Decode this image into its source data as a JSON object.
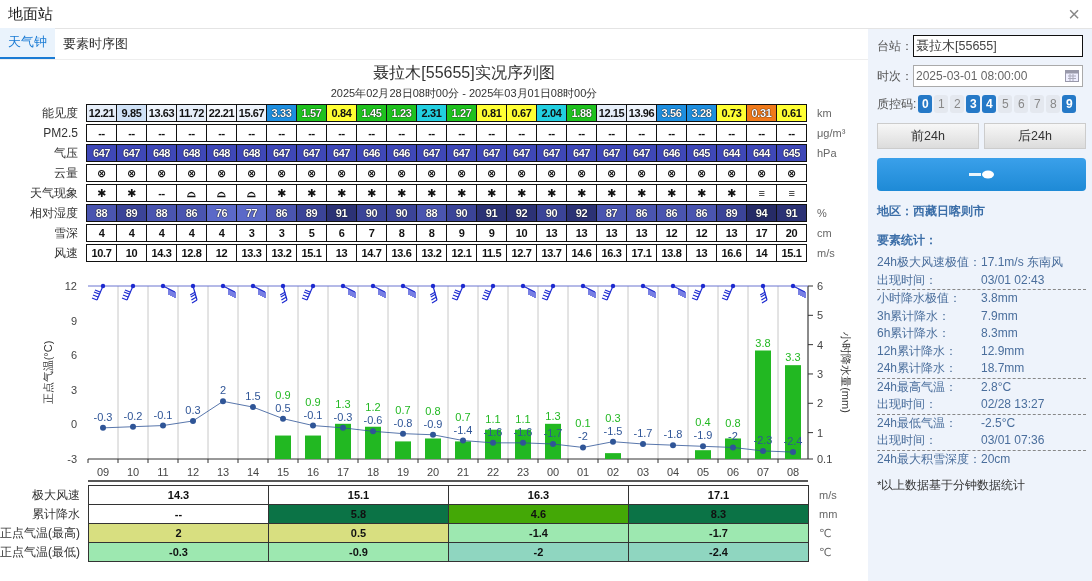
{
  "window": {
    "title": "地面站",
    "close": "×"
  },
  "tabs": [
    {
      "label": "天气钟",
      "selected": true
    },
    {
      "label": "要素时序图",
      "selected": false
    }
  ],
  "report": {
    "title": "聂拉木[55655]实况序列图",
    "subtitle": "2025年02月28日08时00分 - 2025年03月01日08时00分"
  },
  "table": {
    "rows": [
      {
        "label": "能见度",
        "unit": "km",
        "cells": [
          {
            "text": "12.21",
            "color": "#e6eef9"
          },
          {
            "text": "9.85",
            "color": "#cfe1f6"
          },
          {
            "text": "13.63",
            "color": "#edf3fb"
          },
          {
            "text": "11.72",
            "color": "#e6eef9"
          },
          {
            "text": "22.21",
            "color": "#f4f7fc"
          },
          {
            "text": "15.67",
            "color": "#edf3fb"
          },
          {
            "text": "3.33",
            "color": "#1e8fe0"
          },
          {
            "text": "1.57",
            "color": "#1fc21f"
          },
          {
            "text": "0.84",
            "color": "#ffff33"
          },
          {
            "text": "1.45",
            "color": "#1fc21f"
          },
          {
            "text": "1.23",
            "color": "#1fc21f"
          },
          {
            "text": "2.31",
            "color": "#22cfe0"
          },
          {
            "text": "1.27",
            "color": "#1fc21f"
          },
          {
            "text": "0.81",
            "color": "#ffff33"
          },
          {
            "text": "0.67",
            "color": "#ffff33"
          },
          {
            "text": "2.04",
            "color": "#22cfe0"
          },
          {
            "text": "1.88",
            "color": "#1fc21f"
          },
          {
            "text": "12.15",
            "color": "#e6eef9"
          },
          {
            "text": "13.96",
            "color": "#edf3fb"
          },
          {
            "text": "3.56",
            "color": "#1e8fe0"
          },
          {
            "text": "3.28",
            "color": "#1e8fe0"
          },
          {
            "text": "0.73",
            "color": "#ffff33"
          },
          {
            "text": "0.31",
            "color": "#f07a1a"
          },
          {
            "text": "0.61",
            "color": "#ffff33"
          }
        ]
      },
      {
        "label": "PM2.5",
        "unit": "μg/m³",
        "cells": [
          "--",
          "--",
          "--",
          "--",
          "--",
          "--",
          "--",
          "--",
          "--",
          "--",
          "--",
          "--",
          "--",
          "--",
          "--",
          "--",
          "--",
          "--",
          "--",
          "--",
          "--",
          "--",
          "--",
          "--"
        ]
      },
      {
        "label": "气压",
        "unit": "hPa",
        "cells": [
          {
            "text": "647",
            "color": "#3f48b8"
          },
          {
            "text": "647",
            "color": "#3f48b8"
          },
          {
            "text": "648",
            "color": "#3f48b8"
          },
          {
            "text": "648",
            "color": "#3f48b8"
          },
          {
            "text": "648",
            "color": "#3f48b8"
          },
          {
            "text": "648",
            "color": "#3f48b8"
          },
          {
            "text": "647",
            "color": "#3f48b8"
          },
          {
            "text": "647",
            "color": "#3f48b8"
          },
          {
            "text": "647",
            "color": "#3f48b8"
          },
          {
            "text": "646",
            "color": "#3f48b8"
          },
          {
            "text": "646",
            "color": "#3f48b8"
          },
          {
            "text": "647",
            "color": "#3f48b8"
          },
          {
            "text": "647",
            "color": "#3f48b8"
          },
          {
            "text": "647",
            "color": "#3f48b8"
          },
          {
            "text": "647",
            "color": "#3f48b8"
          },
          {
            "text": "647",
            "color": "#3f48b8"
          },
          {
            "text": "647",
            "color": "#3f48b8"
          },
          {
            "text": "647",
            "color": "#3f48b8"
          },
          {
            "text": "647",
            "color": "#3f48b8"
          },
          {
            "text": "646",
            "color": "#3f48b8"
          },
          {
            "text": "645",
            "color": "#3f48b8"
          },
          {
            "text": "644",
            "color": "#3f48b8"
          },
          {
            "text": "644",
            "color": "#3f48b8"
          },
          {
            "text": "645",
            "color": "#3f48b8"
          }
        ]
      },
      {
        "label": "云量",
        "cells": [
          "⊗",
          "⊗",
          "⊗",
          "⊗",
          "⊗",
          "⊗",
          "⊗",
          "⊗",
          "⊗",
          "⊗",
          "⊗",
          "⊗",
          "⊗",
          "⊗",
          "⊗",
          "⊗",
          "⊗",
          "⊗",
          "⊗",
          "⊗",
          "⊗",
          "⊗",
          "⊗",
          "⊗"
        ]
      },
      {
        "label": "天气现象",
        "cells": [
          "✱",
          "✱",
          "--",
          "⌓",
          "⌓",
          "⌓",
          "✱",
          "✱",
          "✱",
          "✱",
          "✱",
          "✱",
          "✱",
          "✱",
          "✱",
          "✱",
          "✱",
          "✱",
          "✱",
          "✱",
          "✱",
          "✱",
          "≡",
          "≡"
        ]
      },
      {
        "label": "相对湿度",
        "unit": "%",
        "cells": [
          {
            "text": "88",
            "color": "#4a55b0"
          },
          {
            "text": "89",
            "color": "#3b4498"
          },
          {
            "text": "88",
            "color": "#4a55b0"
          },
          {
            "text": "86",
            "color": "#4a55b0"
          },
          {
            "text": "76",
            "color": "#5b69c8"
          },
          {
            "text": "77",
            "color": "#5b69c8"
          },
          {
            "text": "86",
            "color": "#4a55b0"
          },
          {
            "text": "89",
            "color": "#3b4498"
          },
          {
            "text": "91",
            "color": "#2c3275"
          },
          {
            "text": "90",
            "color": "#3b4498"
          },
          {
            "text": "90",
            "color": "#3b4498"
          },
          {
            "text": "88",
            "color": "#4a55b0"
          },
          {
            "text": "90",
            "color": "#3b4498"
          },
          {
            "text": "91",
            "color": "#2c3275"
          },
          {
            "text": "92",
            "color": "#2c3275"
          },
          {
            "text": "90",
            "color": "#3b4498"
          },
          {
            "text": "92",
            "color": "#2c3275"
          },
          {
            "text": "87",
            "color": "#4a55b0"
          },
          {
            "text": "86",
            "color": "#4a55b0"
          },
          {
            "text": "86",
            "color": "#4a55b0"
          },
          {
            "text": "86",
            "color": "#4a55b0"
          },
          {
            "text": "89",
            "color": "#3b4498"
          },
          {
            "text": "94",
            "color": "#262b66"
          },
          {
            "text": "91",
            "color": "#2c3275"
          }
        ]
      },
      {
        "label": "雪深",
        "unit": "cm",
        "cells": [
          "4",
          "4",
          "4",
          "4",
          "4",
          "3",
          "3",
          "5",
          "6",
          "7",
          "8",
          "8",
          "9",
          "9",
          "10",
          "13",
          "13",
          "13",
          "13",
          "12",
          "12",
          "13",
          "17",
          "20"
        ]
      },
      {
        "label": "风速",
        "unit": "m/s",
        "cells": [
          "10.7",
          "10",
          "14.3",
          "12.8",
          "12",
          "13.3",
          "13.2",
          "15.1",
          "13",
          "14.7",
          "13.6",
          "13.2",
          "12.1",
          "11.5",
          "12.7",
          "13.7",
          "14.6",
          "16.3",
          "17.1",
          "13.8",
          "13",
          "16.6",
          "14",
          "15.1"
        ]
      }
    ]
  },
  "chart": {
    "wind_barbs": [
      {
        "kind": "sw"
      },
      {
        "kind": "sw"
      },
      {
        "kind": "se"
      },
      {
        "kind": "s"
      },
      {
        "kind": "se"
      },
      {
        "kind": "se"
      },
      {
        "kind": "s"
      },
      {
        "kind": "sw"
      },
      {
        "kind": "se"
      },
      {
        "kind": "se"
      },
      {
        "kind": "se"
      },
      {
        "kind": "s"
      },
      {
        "kind": "sw"
      },
      {
        "kind": "sw"
      },
      {
        "kind": "se"
      },
      {
        "kind": "sw"
      },
      {
        "kind": "se"
      },
      {
        "kind": "sw"
      },
      {
        "kind": "se"
      },
      {
        "kind": "se"
      },
      {
        "kind": "sw"
      },
      {
        "kind": "sw"
      },
      {
        "kind": "s"
      },
      {
        "kind": "se"
      }
    ],
    "temperature": {
      "chart_data": {
        "type": "line",
        "ylabel": "正点气温(°C)",
        "series": [
          {
            "marker": true,
            "color": "#2f5597",
            "values": [
              -0.3,
              -0.2,
              -0.1,
              0.3,
              2,
              1.5,
              0.5,
              -0.1,
              -0.3,
              -0.6,
              -0.8,
              -0.9,
              -1.4,
              -1.6,
              -1.6,
              -1.7,
              -2,
              -1.5,
              -1.7,
              -1.8,
              -1.9,
              -2,
              -2.3,
              -2.4
            ]
          }
        ],
        "ylim": [
          -3,
          12
        ],
        "yticks": [
          -3,
          0,
          3,
          6,
          9,
          12
        ],
        "data_labels": true
      }
    },
    "precipitation": {
      "chart_data": {
        "type": "bar",
        "ylabel": "小时降水量(mm)",
        "categories": [
          "09",
          "10",
          "11",
          "12",
          "13",
          "14",
          "15",
          "16",
          "17",
          "18",
          "19",
          "20",
          "21",
          "22",
          "23",
          "00",
          "01",
          "02",
          "03",
          "04",
          "05",
          "06",
          "07",
          "08"
        ],
        "series": [
          {
            "color": "#22b822",
            "values": [
              null,
              null,
              null,
              null,
              null,
              null,
              0.9,
              0.9,
              1.3,
              1.2,
              0.7,
              0.8,
              0.7,
              1.1,
              1.1,
              1.3,
              0.1,
              0.3,
              null,
              null,
              0.4,
              0.8,
              3.8,
              3.3
            ]
          }
        ],
        "ylim": [
          0.1,
          6
        ],
        "yticks": [
          0.1,
          1,
          2,
          3,
          4,
          5,
          6
        ],
        "data_labels": true
      }
    }
  },
  "summary": {
    "rows": [
      {
        "label": "极大风速",
        "unit": "m/s",
        "cells": [
          {
            "text": "14.3",
            "color": "#ffffff"
          },
          {
            "text": "15.1",
            "color": "#ffffff"
          },
          {
            "text": "16.3",
            "color": "#ffffff"
          },
          {
            "text": "17.1",
            "color": "#ffffff"
          }
        ]
      },
      {
        "label": "累计降水",
        "unit": "mm",
        "cells": [
          {
            "text": "--",
            "color": "#ffffff"
          },
          {
            "text": "5.8",
            "color": "#0b7346"
          },
          {
            "text": "4.6",
            "color": "#44a806"
          },
          {
            "text": "8.3",
            "color": "#0b7346"
          }
        ]
      },
      {
        "label": "正点气温(最高)",
        "unit": "℃",
        "cells": [
          {
            "text": "2",
            "color": "#d8df80"
          },
          {
            "text": "0.5",
            "color": "#d8df80"
          },
          {
            "text": "-1.4",
            "color": "#9de8b0"
          },
          {
            "text": "-1.7",
            "color": "#9de8b0"
          }
        ]
      },
      {
        "label": "正点气温(最低)",
        "unit": "℃",
        "cells": [
          {
            "text": "-0.3",
            "color": "#9de8b0"
          },
          {
            "text": "-0.9",
            "color": "#9de8b0"
          },
          {
            "text": "-2",
            "color": "#8fd6c0"
          },
          {
            "text": "-2.4",
            "color": "#8fd6c0"
          }
        ]
      }
    ]
  },
  "side": {
    "station": {
      "label": "台站：",
      "value": "聂拉木[55655]"
    },
    "time": {
      "label": "时次：",
      "value": "2025-03-01 08:00:00"
    },
    "qc": {
      "label": "质控码:",
      "codes": [
        {
          "label": "0",
          "selected": true
        },
        {
          "label": "1",
          "selected": false
        },
        {
          "label": "2",
          "selected": false
        },
        {
          "label": "3",
          "selected": true
        },
        {
          "label": "4",
          "selected": true
        },
        {
          "label": "5",
          "selected": false
        },
        {
          "label": "6",
          "selected": false
        },
        {
          "label": "7",
          "selected": false
        },
        {
          "label": "8",
          "selected": false
        },
        {
          "label": "9",
          "selected": true
        }
      ]
    },
    "buttons": [
      "前24h",
      "后24h"
    ],
    "region": "地区：西藏日喀则市",
    "stats_title": "要素统计：",
    "stats": [
      [
        {
          "label": "24h极大风速极值：",
          "value": "17.1m/s 东南风"
        },
        {
          "label": "出现时间：",
          "value": "03/01 02:43"
        }
      ],
      [
        {
          "label": "小时降水极值：",
          "value": "3.8mm"
        },
        {
          "label": "3h累计降水：",
          "value": "7.9mm"
        },
        {
          "label": "6h累计降水：",
          "value": "8.3mm"
        },
        {
          "label": "12h累计降水：",
          "value": "12.9mm"
        },
        {
          "label": "24h累计降水：",
          "value": "18.7mm"
        }
      ],
      [
        {
          "label": "24h最高气温：",
          "value": "2.8°C"
        },
        {
          "label": "出现时间：",
          "value": "02/28 13:27"
        }
      ],
      [
        {
          "label": "24h最低气温：",
          "value": "-2.5°C"
        },
        {
          "label": "出现时间：",
          "value": "03/01 07:36"
        }
      ],
      [
        {
          "label": "24h最大积雪深度：",
          "value": "20cm"
        }
      ]
    ],
    "note": "*以上数据基于分钟数据统计"
  }
}
